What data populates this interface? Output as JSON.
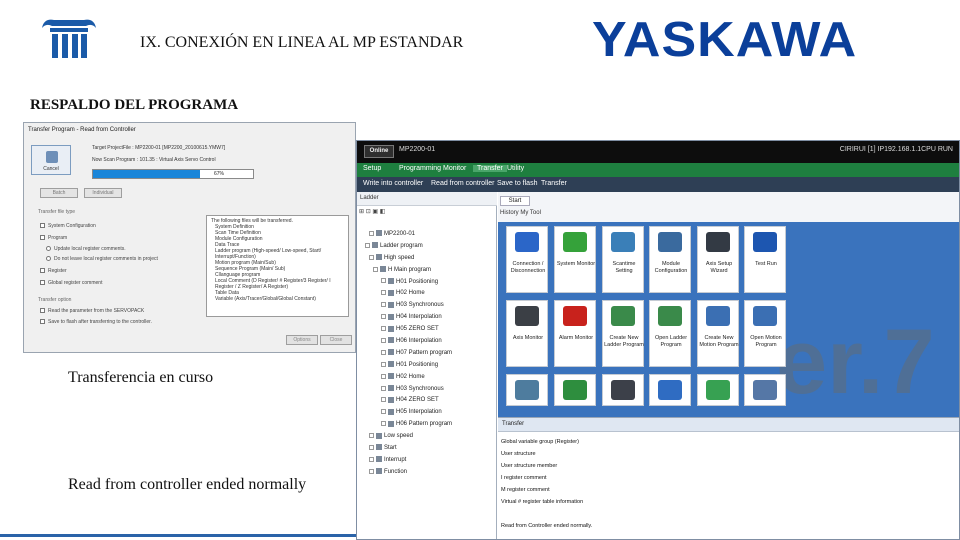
{
  "slide": {
    "title": "IX.  CONEXIÓN EN LINEA AL MP ESTANDAR",
    "brand": "YASKAWA",
    "section": "RESPALDO DEL PROGRAMA",
    "caption_progress": "Transferencia en curso",
    "caption_done": "Read from controller ended normally"
  },
  "dialog": {
    "title": "Transfer Program - Read from Controller",
    "cancel_label": "Cancel",
    "target_line": "Target ProjectFile : MP2200-01    [MP2200_20100615.YMW7]",
    "status_line": "Now Scan Program : 101.35 : Virtual Axis Servo Control",
    "progress_fraction": 0.67,
    "progress_text": "67%",
    "batch_label": "Batch",
    "individual_label": "Individual",
    "transfer_type_label": "Transfer file type",
    "checks": [
      "System Configuration",
      "Program",
      "Update local register comments.",
      "Do not leave local register comments in project",
      "Register",
      "Global register comment"
    ],
    "transfer_option_label": "Transfer option",
    "options": [
      "Read the parameter from the SERVOPACK",
      "Save to flash after transferring to the controller."
    ],
    "files": [
      "The following files will be transferred.",
      "System Definition",
      "Scan Time Definition",
      "Module Configuration",
      "Data Trace",
      "Ladder program (High-speed/ Low-speed, Start/",
      "Interrupt/Function)",
      "Motion program (Main/Sub)",
      "Sequence Program (Main/ Sub)",
      "Cllanguage program",
      "Local Comment (D Register/ # Register/3 Register/ I",
      "Register / Z Register/ A Register)",
      "Table Data",
      "Variable (Axis/Tracer/Global/Global Constant)"
    ],
    "options_btn": "Options",
    "close_btn": "Close"
  },
  "app": {
    "status": "Online",
    "model": "MP2200-01",
    "connection": "CIRIRUI [1] IP192.168.1.1CPU RUN",
    "menus": [
      "Setup",
      "Programming",
      "Monitor",
      "Transfer",
      "Utility"
    ],
    "active_menu": "Transfer",
    "submenus": [
      "Write into controller",
      "Read from controller",
      "Save to flash",
      "Transfer"
    ],
    "left_pane_title": "Ladder",
    "tree_header": "Program",
    "tree": [
      "MP2200-01",
      "Ladder program",
      "High speed",
      "H Main program",
      "H01 Positioning",
      "H02 Home",
      "H03 Synchronous",
      "H04 Interpolation",
      "H05 ZERO SET",
      "H06 Interpolation",
      "H07 Pattern program",
      "H01 Positioning",
      "H02 Home",
      "H03 Synchronous",
      "H04 ZERO SET",
      "H05 Interpolation",
      "H06 Pattern program",
      "Low speed",
      "Start",
      "Interrupt",
      "Function"
    ],
    "start_tab": "Start",
    "start_tools": "History    My Tool",
    "watermark": "er.7",
    "tiles": [
      {
        "label": "Connection / Disconnection",
        "color": "#2b66c8"
      },
      {
        "label": "System Monitor",
        "color": "#35a23a"
      },
      {
        "label": "Scantime Setting",
        "color": "#3a7fb8"
      },
      {
        "label": "Module Configuration",
        "color": "#3a6a9e"
      },
      {
        "label": "Axis Setup Wizard",
        "color": "#333a44"
      },
      {
        "label": "Test Run",
        "color": "#1d56b0"
      },
      {
        "label": "Axis Monitor",
        "color": "#3b3f45"
      },
      {
        "label": "Alarm Monitor",
        "color": "#c8221c"
      },
      {
        "label": "Create New Ladder Program",
        "color": "#3a8a4a"
      },
      {
        "label": "Open Ladder Program",
        "color": "#3a8a4a"
      },
      {
        "label": "Create New Motion Program",
        "color": "#3b6fb3"
      },
      {
        "label": "Open Motion Program",
        "color": "#3b6fb3"
      },
      {
        "label": "",
        "color": "#4e7c9e"
      },
      {
        "label": "",
        "color": "#2e8e3e"
      },
      {
        "label": "",
        "color": "#3c4049"
      },
      {
        "label": "",
        "color": "#2f6cc2"
      },
      {
        "label": "",
        "color": "#37a152"
      },
      {
        "label": "",
        "color": "#5577a6"
      }
    ],
    "transfer_title": "Transfer",
    "log": [
      "Global variable group (Register)",
      "User structure",
      "User structure member",
      "I register comment",
      "M register comment",
      "Virtual # register table information",
      "",
      "Read from Controller ended normally."
    ]
  }
}
